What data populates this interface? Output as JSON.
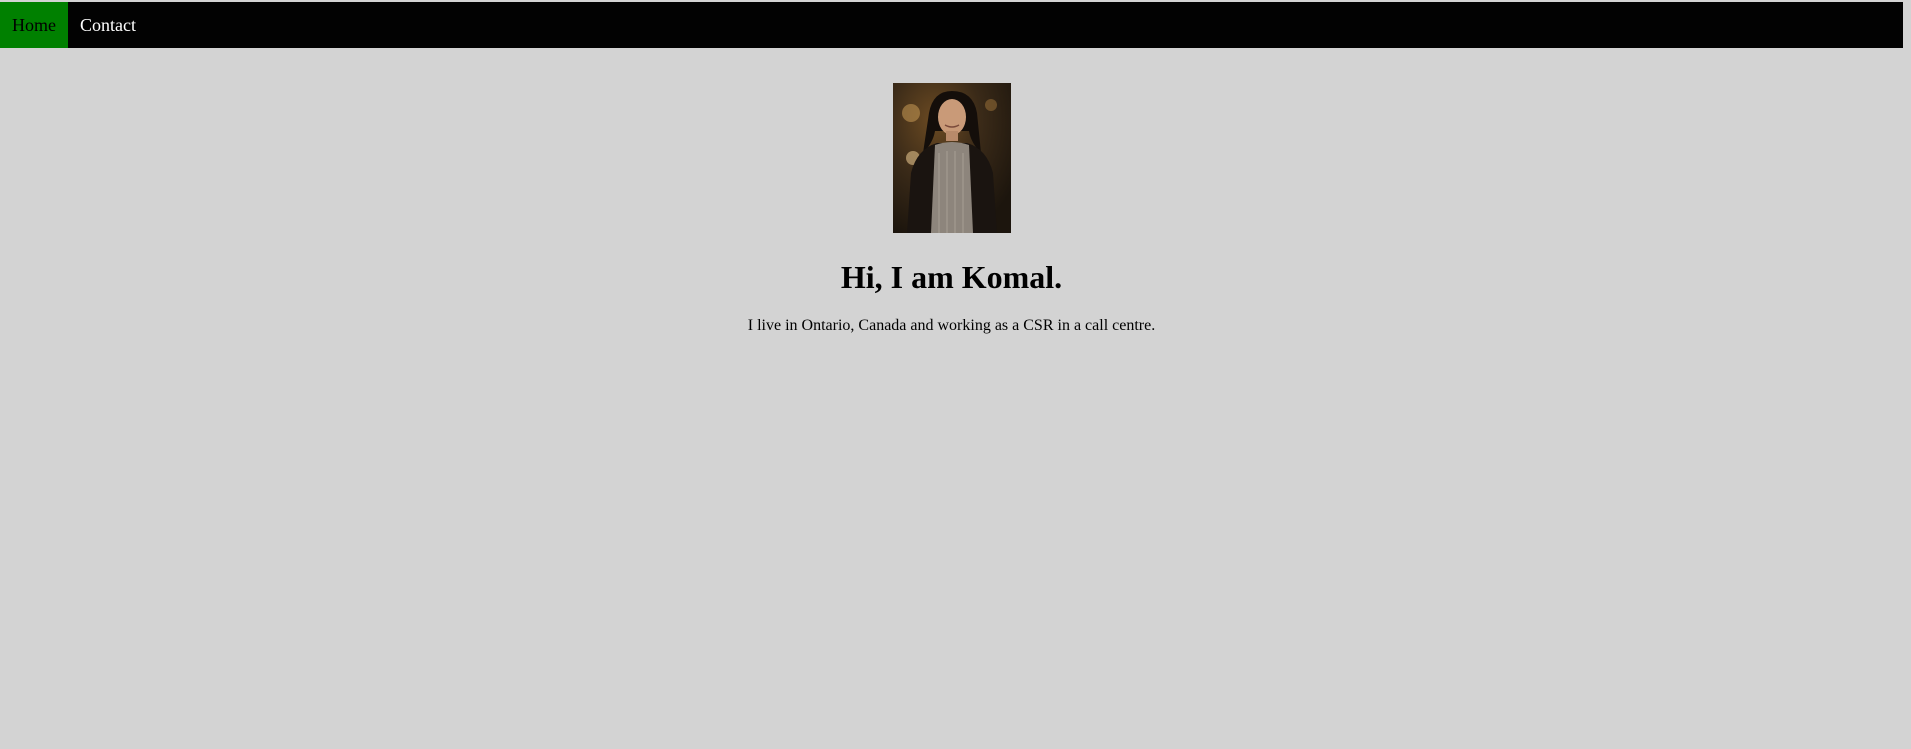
{
  "nav": {
    "items": [
      {
        "label": "Home",
        "active": true
      },
      {
        "label": "Contact",
        "active": false
      }
    ],
    "active_color": "#008000",
    "bar_color": "#020202"
  },
  "profile": {
    "photo_icon": "profile-photo",
    "heading": "Hi, I am Komal.",
    "bio": "I live in Ontario, Canada and working as a CSR in a call centre."
  },
  "theme": {
    "page_background": "#d3d3d3"
  }
}
